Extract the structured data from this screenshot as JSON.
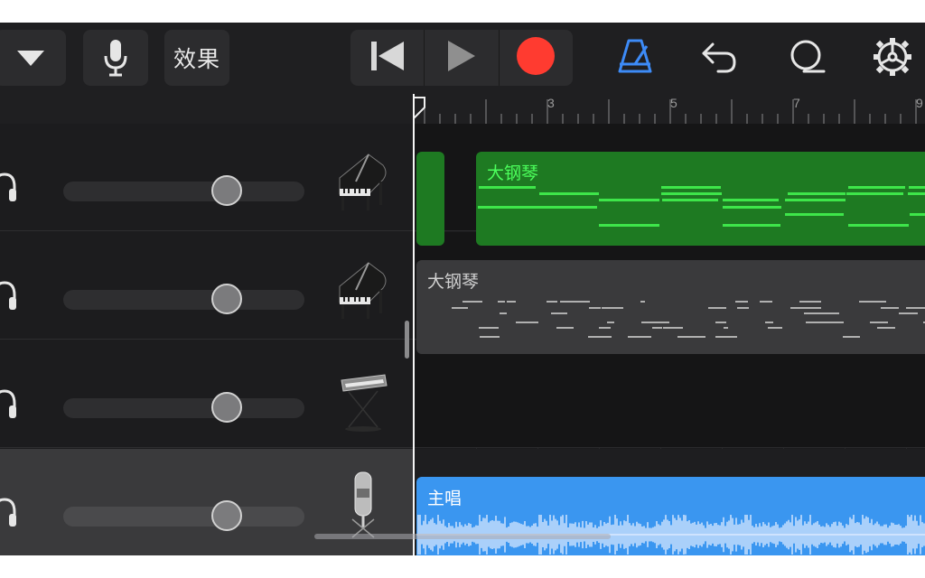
{
  "toolbar": {
    "dropdown_icon": "triangle-down-icon",
    "mic_icon": "microphone-icon",
    "fx_label": "效果",
    "rewind_icon": "skip-back-icon",
    "play_icon": "play-icon",
    "record_icon": "record-icon",
    "metronome_icon": "metronome-icon",
    "undo_icon": "undo-icon",
    "loop_icon": "loop-browser-icon",
    "settings_icon": "gear-icon",
    "colors": {
      "record": "#ff3b30",
      "metronome_active": "#3d8bf7"
    }
  },
  "ruler": {
    "bars": [
      "3",
      "5",
      "7",
      "9"
    ]
  },
  "tracks": [
    {
      "instrument": "grand-piano",
      "volume": 0.68,
      "selected": false
    },
    {
      "instrument": "grand-piano",
      "volume": 0.68,
      "selected": false
    },
    {
      "instrument": "keyboard-synth",
      "volume": 0.68,
      "selected": false
    },
    {
      "instrument": "vocal-microphone",
      "volume": 0.68,
      "selected": true
    }
  ],
  "regions": {
    "piano_green": {
      "label": "大钢琴",
      "color": "#1e7a22",
      "note_color": "#3ee64a"
    },
    "piano_gray": {
      "label": "大钢琴",
      "color": "#3a3a3c",
      "note_color": "#b0b0b0"
    },
    "vocal": {
      "label": "主唱",
      "color": "#3a96f0",
      "wave_color": "#dbe9ff"
    }
  }
}
